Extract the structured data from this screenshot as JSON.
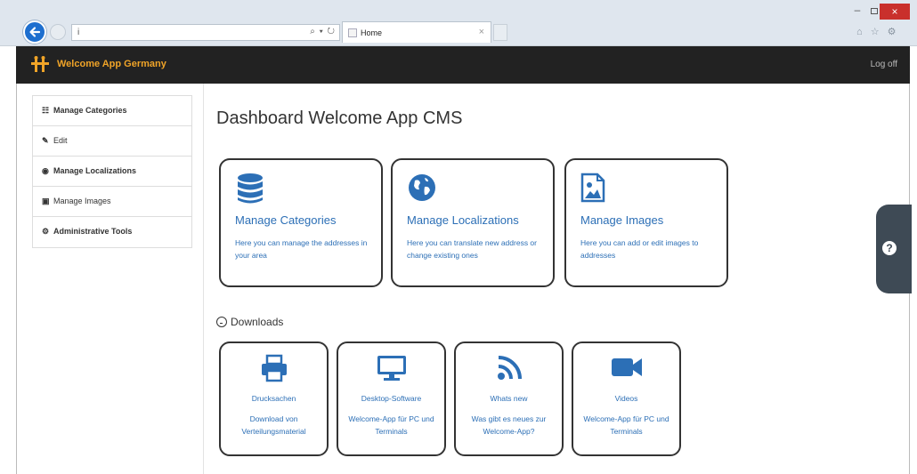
{
  "browser": {
    "address": "i",
    "address_controls": "⌕ ▾ ↻",
    "tab_title": "Home",
    "tab_close": "×",
    "window_minimize": "–",
    "window_close": "×",
    "tool_icons": "⌂ ☆ ⚙"
  },
  "navbar": {
    "brand": "Welcome App Germany",
    "logout": "Log off",
    "brand_color": "#f0a428",
    "background": "#222222"
  },
  "sidebar": {
    "items": [
      {
        "label": "Manage Categories",
        "icon": "grid-icon",
        "glyph": "☷"
      },
      {
        "label": "Edit",
        "icon": "pencil-icon",
        "glyph": "✎"
      },
      {
        "label": "Manage Localizations",
        "icon": "globe-icon",
        "glyph": "◉"
      },
      {
        "label": "Manage Images",
        "icon": "image-icon",
        "glyph": "▣"
      },
      {
        "label": "Administrative Tools",
        "icon": "gear-icon",
        "glyph": "⚙"
      }
    ]
  },
  "main": {
    "title": "Dashboard Welcome App CMS",
    "tiles": [
      {
        "icon": "database-icon",
        "title": "Manage Categories",
        "desc": "Here you can manage the addresses in your area"
      },
      {
        "icon": "globe-icon",
        "title": "Manage Localizations",
        "desc": "Here you can translate new address or change existing ones"
      },
      {
        "icon": "image-icon",
        "title": "Manage Images",
        "desc": "Here you can add or edit images to addresses"
      }
    ],
    "downloads": {
      "title": "Downloads",
      "items": [
        {
          "icon": "printer-icon",
          "title": "Drucksachen",
          "desc": "Download von Verteilungsmaterial"
        },
        {
          "icon": "desktop-icon",
          "title": "Desktop-Software",
          "desc": "Welcome-App für PC und Terminals"
        },
        {
          "icon": "rss-icon",
          "title": "Whats new",
          "desc": "Was gibt es neues zur Welcome-App?"
        },
        {
          "icon": "video-camera-icon",
          "title": "Videos",
          "desc": "Welcome-App für PC und Terminals"
        }
      ]
    },
    "link_color": "#2c6fb6"
  },
  "help": {
    "glyph": "?"
  }
}
